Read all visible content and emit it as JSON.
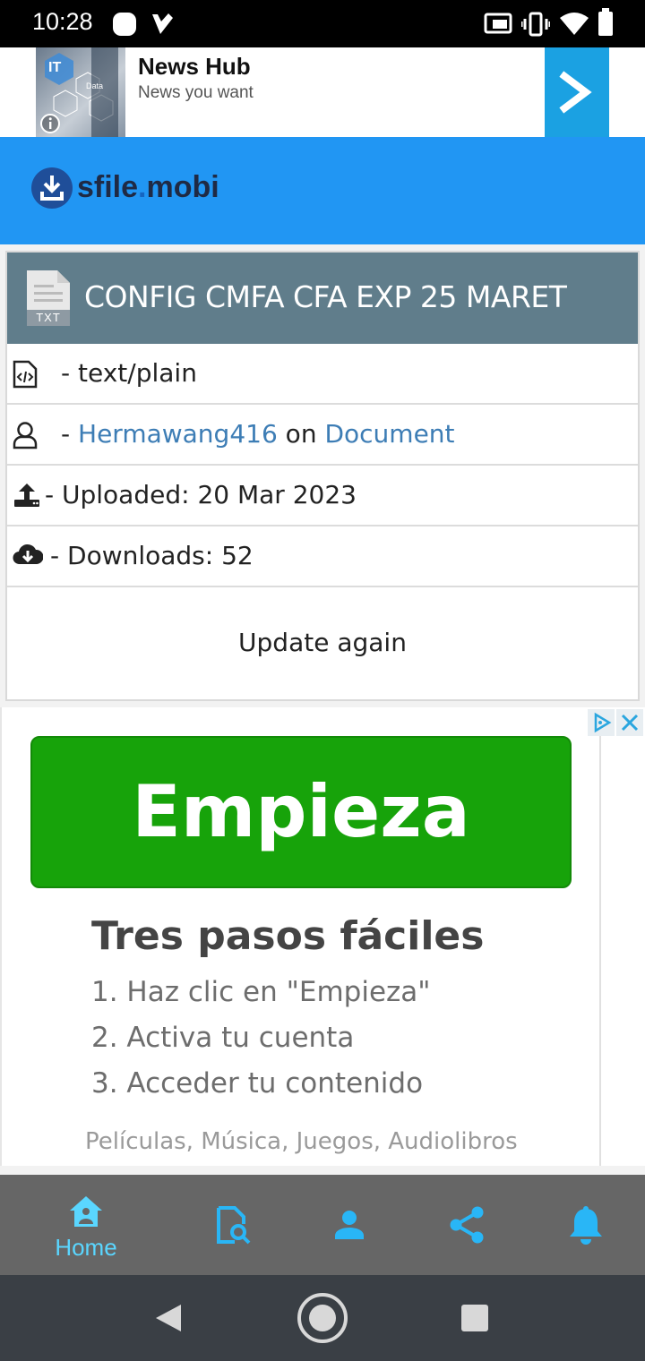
{
  "status_bar": {
    "time": "10:28"
  },
  "top_ad": {
    "title": "News Hub",
    "subtitle": "News you want",
    "image_badge": "IT",
    "image_label": "Data"
  },
  "header": {
    "logo_text_1": "sfile",
    "logo_text_2": ".",
    "logo_text_3": "mobi"
  },
  "file": {
    "icon_label": "TXT",
    "title": "CONFIG CMFA CFA EXP 25 MARET",
    "type_text": "- text/plain",
    "uploader_prefix": "- ",
    "uploader": "Hermawang416",
    "uploader_on": " on ",
    "category": "Document",
    "uploaded_text": "- Uploaded: 20 Mar 2023",
    "downloads_text": "- Downloads: 52",
    "update_label": "Update again"
  },
  "bottom_ad": {
    "button": "Empieza",
    "heading": "Tres pasos fáciles",
    "steps": [
      "1. Haz clic en \"Empieza\"",
      "2. Activa tu cuenta",
      "3. Acceder tu contenido"
    ],
    "footer": "Películas, Música, Juegos, Audiolibros"
  },
  "bottom_nav": {
    "items": [
      {
        "label": "Home",
        "icon": "home-icon"
      },
      {
        "label": "",
        "icon": "file-search-icon"
      },
      {
        "label": "",
        "icon": "user-icon"
      },
      {
        "label": "",
        "icon": "share-icon"
      },
      {
        "label": "",
        "icon": "bell-icon"
      }
    ]
  },
  "colors": {
    "accent": "#2196f3",
    "title_bar": "#607d8b",
    "link": "#3d7db5",
    "ad_green": "#17a30a",
    "nav_active": "#5ad6ff",
    "nav_icon": "#29b6f6"
  }
}
